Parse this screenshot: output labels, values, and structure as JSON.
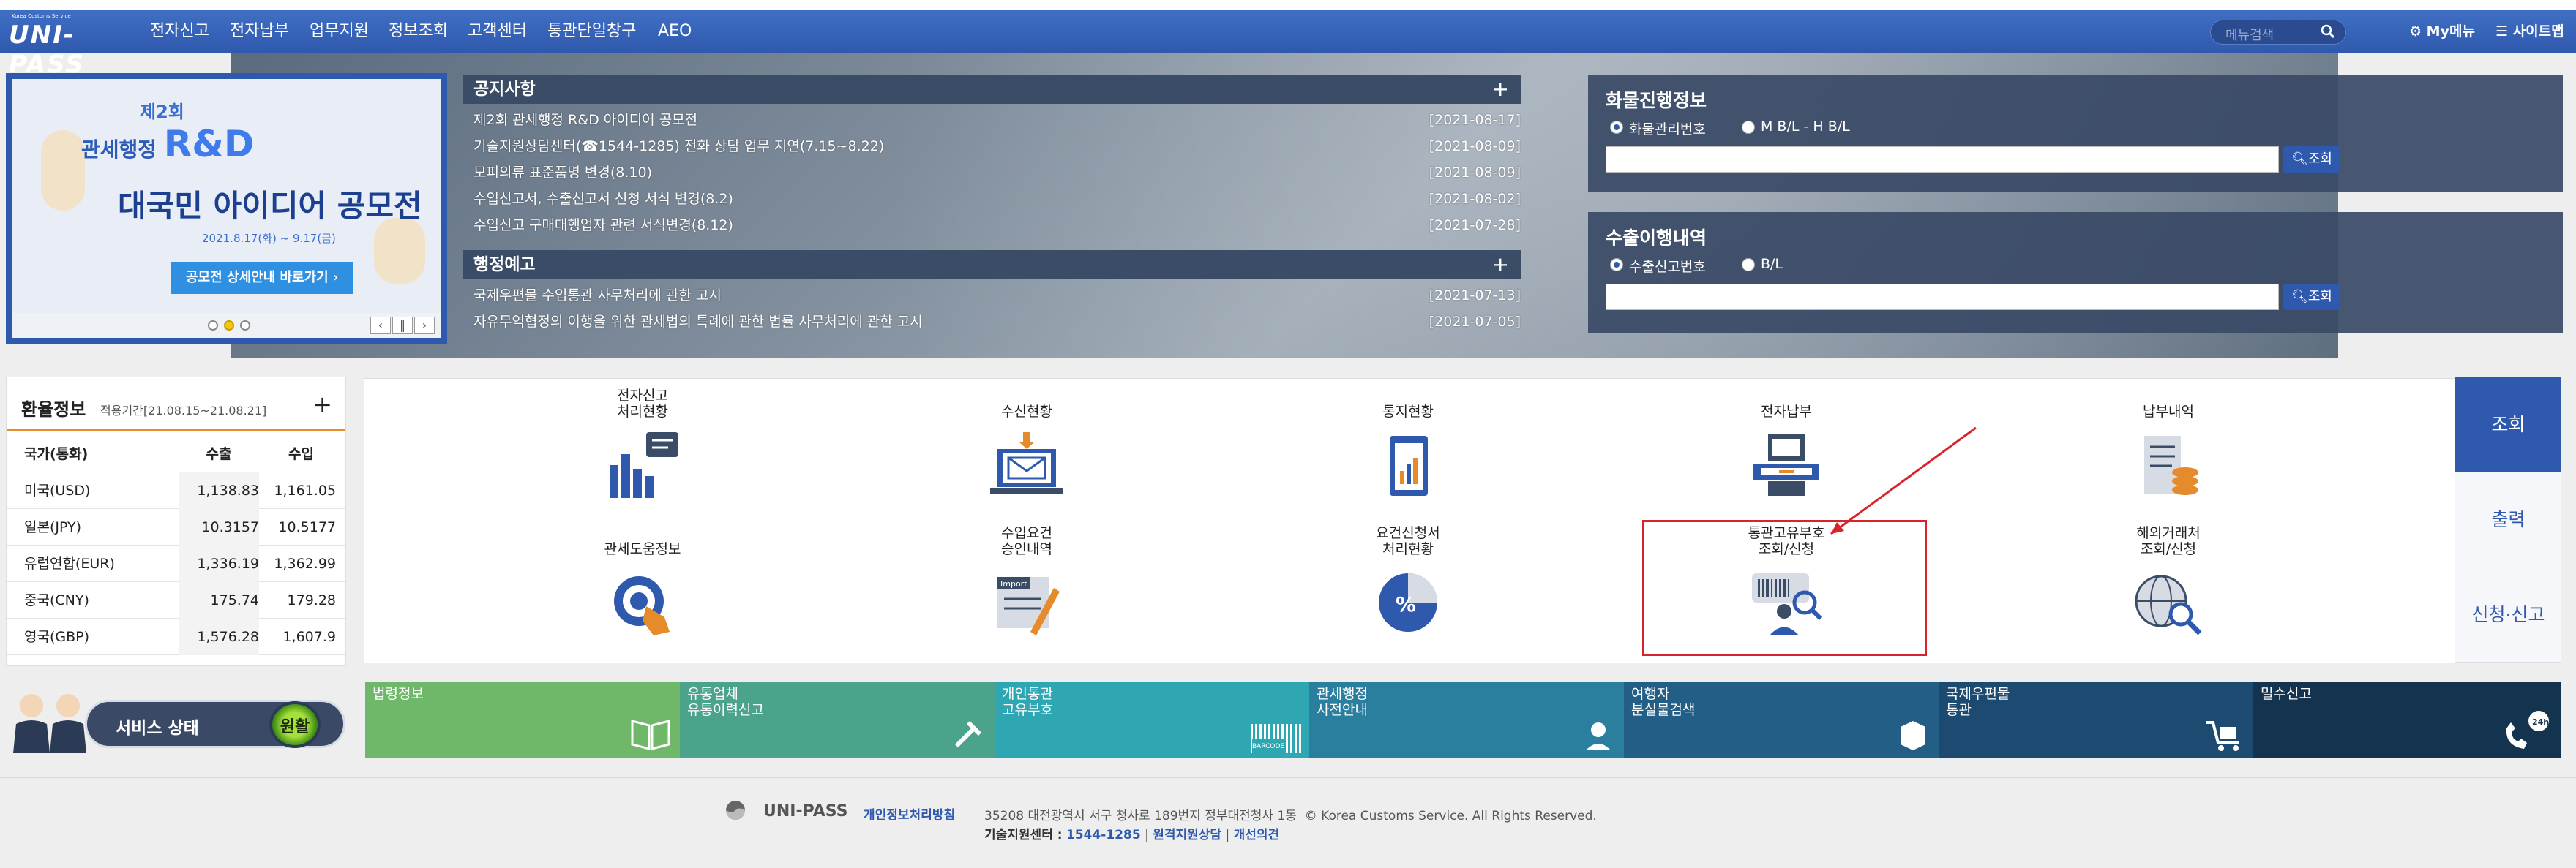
{
  "header": {
    "logo_text": "UNI-PASS",
    "logo_sub": "Korea Customs Service",
    "nav": [
      "전자신고",
      "전자납부",
      "업무지원",
      "정보조회",
      "고객센터",
      "통관단일창구",
      "AEO"
    ],
    "search_placeholder": "메뉴검색",
    "my_menu": "My메뉴",
    "sitemap": "사이트맵"
  },
  "banner": {
    "line1": "제2회",
    "line2_prefix": "관세행정",
    "line2_big": "R&D",
    "line3": "대국민 아이디어 공모전",
    "period": "2021.8.17(화) ~ 9.17(금)",
    "button": "공모전 상세안내 바로가기"
  },
  "notices": {
    "title": "공지사항",
    "items": [
      {
        "text": "제2회 관세행정 R&D 아이디어 공모전",
        "date": "[2021-08-17]"
      },
      {
        "text": "기술지원상담센터(☎1544-1285) 전화 상담 업무 지연(7.15~8.22)",
        "date": "[2021-08-09]"
      },
      {
        "text": "모피의류 표준품명 변경(8.10)",
        "date": "[2021-08-09]"
      },
      {
        "text": "수입신고서, 수출신고서 신청 서식 변경(8.2)",
        "date": "[2021-08-02]"
      },
      {
        "text": "수입신고 구매대행업자 관련 서식변경(8.12)",
        "date": "[2021-07-28]"
      }
    ]
  },
  "admin_notices": {
    "title": "행정예고",
    "items": [
      {
        "text": "국제우편물 수입통관 사무처리에 관한 고시",
        "date": "[2021-07-13]"
      },
      {
        "text": "자유무역협정의 이행을 위한 관세법의 특례에 관한 법률 사무처리에 관한 고시",
        "date": "[2021-07-05]"
      }
    ]
  },
  "cargo": {
    "title": "화물진행정보",
    "opt1": "화물관리번호",
    "opt2": "M B/L - H B/L",
    "button": "조회"
  },
  "export": {
    "title": "수출이행내역",
    "opt1": "수출신고번호",
    "opt2": "B/L",
    "button": "조회"
  },
  "exchange": {
    "title": "환율정보",
    "period": "적용기간[21.08.15~21.08.21]",
    "headers": [
      "국가(통화)",
      "수출",
      "수입"
    ],
    "rows": [
      [
        "미국(USD)",
        "1,138.83",
        "1,161.05"
      ],
      [
        "일본(JPY)",
        "10.3157",
        "10.5177"
      ],
      [
        "유럽연합(EUR)",
        "1,336.19",
        "1,362.99"
      ],
      [
        "중국(CNY)",
        "175.74",
        "179.28"
      ],
      [
        "영국(GBP)",
        "1,576.28",
        "1,607.9"
      ]
    ]
  },
  "status": {
    "label": "서비스 상태",
    "value": "원활"
  },
  "services": [
    {
      "l1": "전자신고",
      "l2": "처리현황"
    },
    {
      "l1": "",
      "l2": "수신현황"
    },
    {
      "l1": "",
      "l2": "통지현황"
    },
    {
      "l1": "",
      "l2": "전자납부"
    },
    {
      "l1": "",
      "l2": "납부내역"
    },
    {
      "l1": "",
      "l2": "관세도움정보"
    },
    {
      "l1": "수입요건",
      "l2": "승인내역"
    },
    {
      "l1": "요건신청서",
      "l2": "처리현황"
    },
    {
      "l1": "통관고유부호",
      "l2": "조회/신청"
    },
    {
      "l1": "해외거래처",
      "l2": "조회/신청"
    }
  ],
  "side_tabs": [
    "조회",
    "출력",
    "신청·신고"
  ],
  "quickbar": [
    {
      "l1": "법령정보",
      "l2": "",
      "color": "#6fb86a"
    },
    {
      "l1": "유통업체",
      "l2": "유통이력신고",
      "color": "#4aa38a"
    },
    {
      "l1": "개인통관",
      "l2": "고유부호",
      "color": "#2fa7b3"
    },
    {
      "l1": "관세행정",
      "l2": "사전안내",
      "color": "#2a7e9e"
    },
    {
      "l1": "여행자",
      "l2": "분실물검색",
      "color": "#225e86"
    },
    {
      "l1": "국제우편물",
      "l2": "통관",
      "color": "#1d4a70"
    },
    {
      "l1": "밀수신고",
      "l2": "",
      "color": "#14334f"
    }
  ],
  "quick_icon_text": {
    "barcode": "BARCODE",
    "h24": "24h"
  },
  "footer": {
    "brand": "UNI-PASS",
    "privacy": "개인정보처리방침",
    "address": "35208 대전광역시 서구 청사로 189번지 정부대전청사 1동",
    "copyright": "© Korea Customs Service. All Rights Reserved.",
    "tech_label": "기술지원센터 :",
    "tech_phone": "1544-1285",
    "remote": "원격지원상담",
    "improve": "개선의견"
  },
  "colors": {
    "nav": "#2f59ad",
    "panel": "#3b4c67",
    "highlight": "#d8232a",
    "accent": "#e58b2c"
  }
}
